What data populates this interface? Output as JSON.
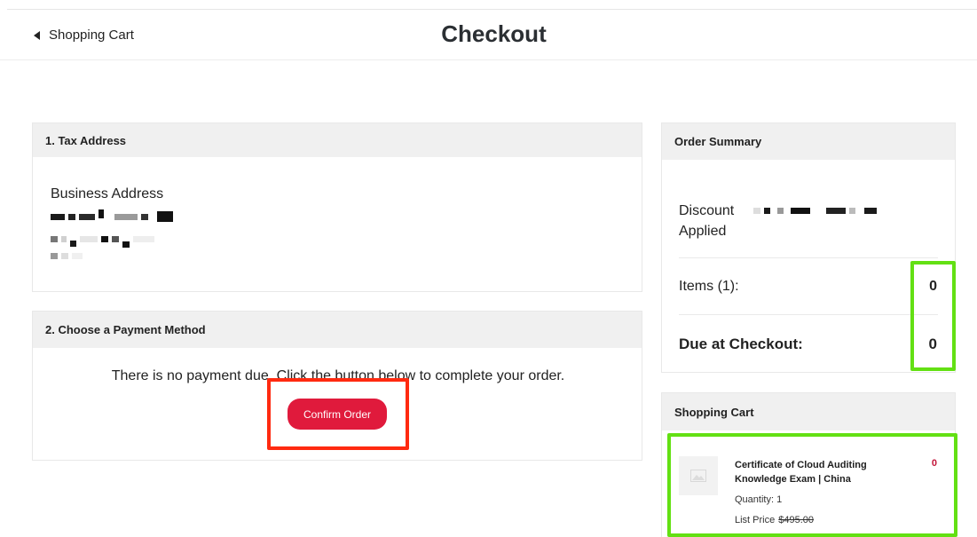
{
  "header": {
    "back_label": "Shopping Cart",
    "title": "Checkout"
  },
  "tax_address": {
    "heading": "1. Tax Address",
    "business_label": "Business Address"
  },
  "payment": {
    "heading": "2. Choose a Payment Method",
    "message": "There is no payment due. Click the button below to complete your order.",
    "confirm_label": "Confirm Order"
  },
  "summary": {
    "heading": "Order Summary",
    "discount_label": "Discount Applied",
    "items_label": "Items (1):",
    "items_value": "0",
    "due_label": "Due at Checkout:",
    "due_value": "0"
  },
  "cart": {
    "heading": "Shopping Cart",
    "item": {
      "name": "Certificate of Cloud Auditing Knowledge Exam | China",
      "price": "0",
      "quantity": "Quantity: 1",
      "list_price_label": "List Price",
      "list_price_value": "$495.00",
      "thumbnail_icon": "image-placeholder-icon"
    }
  },
  "colors": {
    "accent": "#e01a3c",
    "highlight_red": "#ff2a10",
    "highlight_green": "#63e013"
  }
}
